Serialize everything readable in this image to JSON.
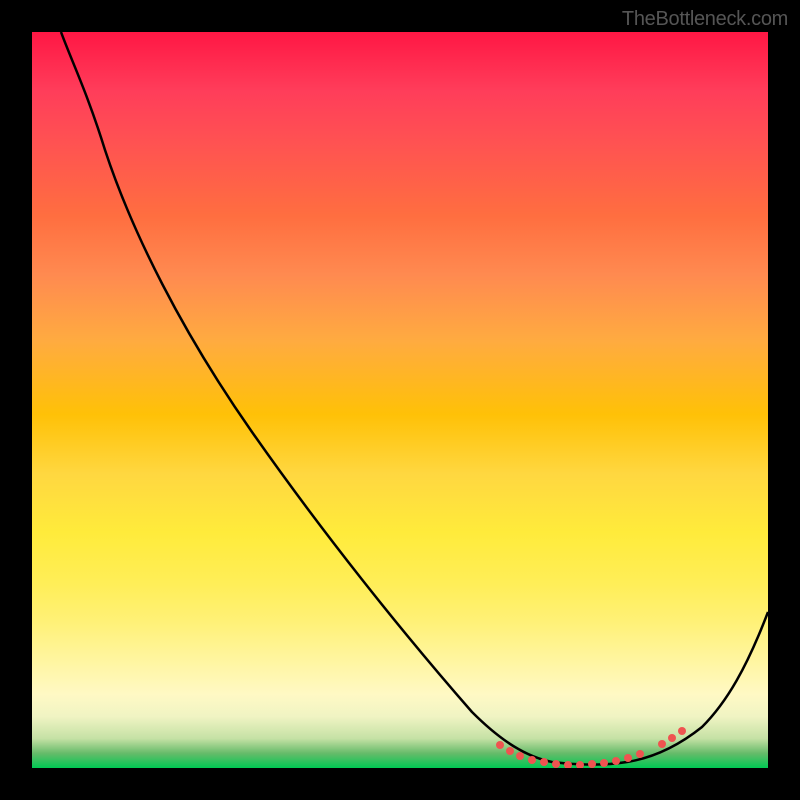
{
  "watermark": "TheBottleneck.com",
  "chart_data": {
    "type": "line",
    "title": "",
    "xlabel": "",
    "ylabel": "",
    "xlim": [
      0,
      100
    ],
    "ylim": [
      0,
      100
    ],
    "grid": false,
    "series": [
      {
        "name": "curve",
        "color": "#000000",
        "x": [
          4,
          10,
          20,
          30,
          40,
          50,
          60,
          64,
          68,
          72,
          76,
          80,
          84,
          88,
          92,
          96,
          100
        ],
        "y": [
          100,
          92,
          77,
          62,
          47,
          32,
          17,
          10,
          5,
          2,
          1,
          0.5,
          1,
          3,
          8,
          15,
          25
        ]
      },
      {
        "name": "optimal-region",
        "color": "#ef5350",
        "marker": "dot",
        "x": [
          64,
          66,
          68,
          70,
          72,
          74,
          76,
          78,
          80,
          82,
          84,
          86,
          88
        ],
        "y": [
          10,
          7,
          5,
          3.5,
          2,
          1.5,
          1,
          0.8,
          0.5,
          0.7,
          1,
          2,
          3
        ]
      }
    ],
    "background_gradient": {
      "top": "#ff1744",
      "middle": "#ffeb3b",
      "bottom": "#00c853"
    }
  }
}
